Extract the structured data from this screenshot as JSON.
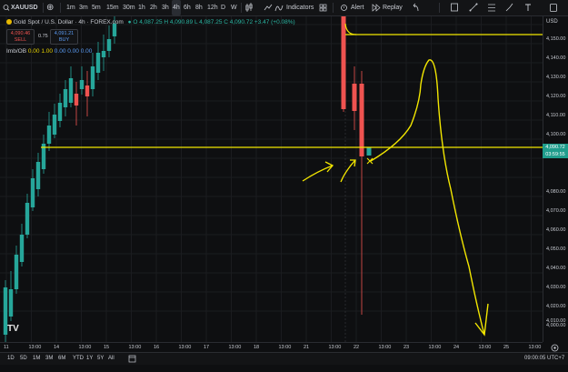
{
  "toolbar": {
    "symbol": "XAUUSD",
    "intervals": [
      "1m",
      "3m",
      "5m",
      "15m",
      "30m",
      "1h",
      "2h",
      "3h",
      "4h",
      "6h",
      "8h",
      "12h",
      "D",
      "W"
    ],
    "active_interval": "4h",
    "indicators_label": "Indicators",
    "alert_label": "Alert",
    "replay_label": "Replay"
  },
  "legend": {
    "title": "Gold Spot / U.S. Dollar · 4h · FOREX.com",
    "ohlc": "O 4,087.25  H 4,090.89  L 4,087.25  C 4,090.72  +3.47 (+0.08%)",
    "sell_price": "4,090.46",
    "sell_label": "SELL",
    "spread": "0.75",
    "buy_price": "4,091.21",
    "buy_label": "BUY",
    "indicator_name": "Imb/OB",
    "indicator_values_yellow": [
      "0.00",
      "1.00"
    ],
    "indicator_values_blue": [
      "0.00",
      "0.00",
      "0.00"
    ]
  },
  "price_axis": {
    "currency": "USD",
    "ticks": [
      "4,150.00",
      "4,140.00",
      "4,130.00",
      "4,120.00",
      "4,110.00",
      "4,100.00",
      "4,080.00",
      "4,070.00",
      "4,060.00",
      "4,050.00",
      "4,040.00",
      "4,030.00",
      "4,020.00",
      "4,010.00",
      "4,000.00"
    ],
    "current_price": "4,090.72",
    "countdown": "03:59:55"
  },
  "time_axis": {
    "labels": [
      "11",
      "13:00",
      "14",
      "13:00",
      "15",
      "13:00",
      "16",
      "13:00",
      "17",
      "13:00",
      "18",
      "13:00",
      "21",
      "13:00",
      "22",
      "13:00",
      "23",
      "13:00",
      "24",
      "13:00",
      "25",
      "13:00"
    ]
  },
  "bottombar": {
    "ranges": [
      "1D",
      "5D",
      "1M",
      "3M",
      "6M",
      "YTD",
      "1Y",
      "5Y",
      "All"
    ],
    "clock": "09:00:05 UTC+7"
  },
  "logo": "TV",
  "colors": {
    "up": "#26a69a",
    "down": "#ef5350",
    "drawing": "#f2e600",
    "background": "#0e0f11"
  }
}
